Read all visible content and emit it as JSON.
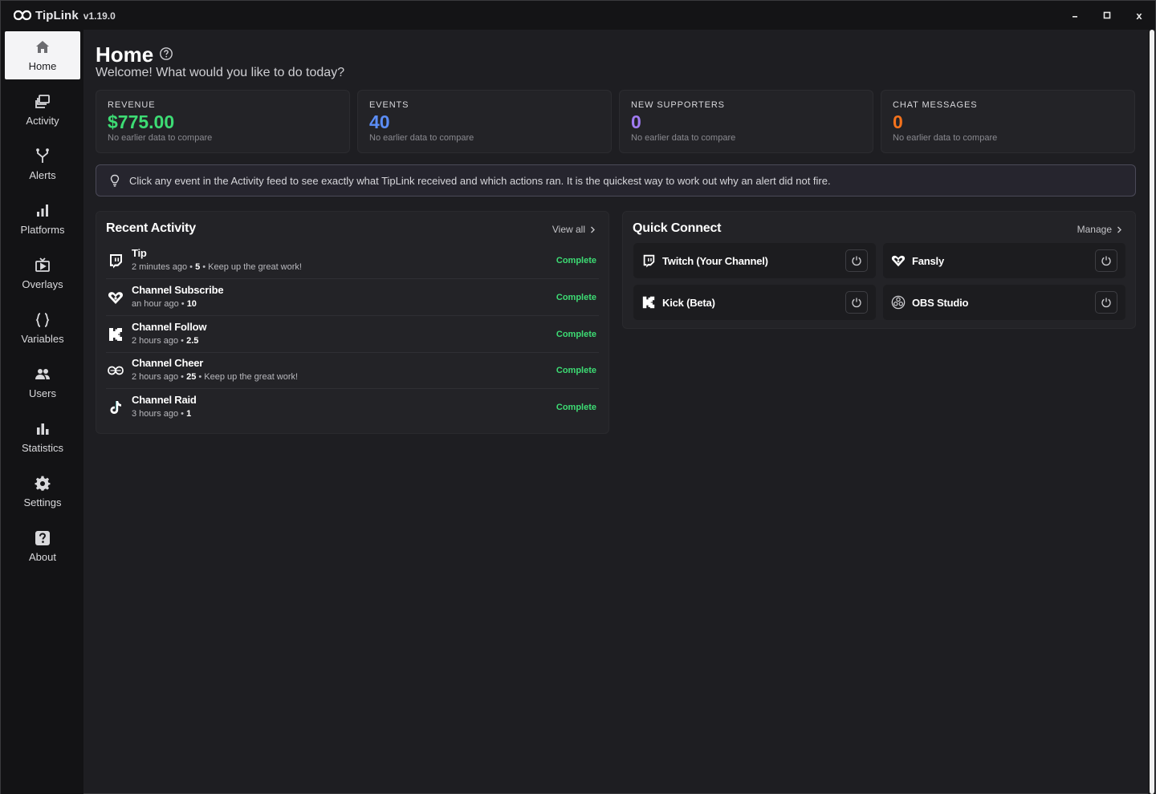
{
  "app": {
    "name": "TipLink",
    "version": "v1.19.0"
  },
  "window_controls": {
    "minimize": "–",
    "maximize": "□",
    "close": "x"
  },
  "sidebar": {
    "items": [
      {
        "label": "Home",
        "icon": "home-icon",
        "active": true
      },
      {
        "label": "Activity",
        "icon": "activity-icon"
      },
      {
        "label": "Alerts",
        "icon": "alerts-icon"
      },
      {
        "label": "Platforms",
        "icon": "platforms-icon"
      },
      {
        "label": "Overlays",
        "icon": "overlays-icon"
      },
      {
        "label": "Variables",
        "icon": "variables-icon"
      },
      {
        "label": "Users",
        "icon": "users-icon"
      },
      {
        "label": "Statistics",
        "icon": "statistics-icon"
      },
      {
        "label": "Settings",
        "icon": "gear-icon"
      },
      {
        "label": "About",
        "icon": "help-icon"
      }
    ]
  },
  "header": {
    "title": "Home",
    "subtitle": "Welcome! What would you like to do today?"
  },
  "stats": [
    {
      "label": "REVENUE",
      "value": "$775.00",
      "note": "No earlier data to compare",
      "color": "#3ddc74"
    },
    {
      "label": "EVENTS",
      "value": "40",
      "note": "No earlier data to compare",
      "color": "#5b8df6"
    },
    {
      "label": "NEW SUPPORTERS",
      "value": "0",
      "note": "No earlier data to compare",
      "color": "#a07bf2"
    },
    {
      "label": "CHAT MESSAGES",
      "value": "0",
      "note": "No earlier data to compare",
      "color": "#f5721c"
    }
  ],
  "tip": {
    "text": "Click any event in the Activity feed to see exactly what TipLink received and which actions ran. It is the quickest way to work out why an alert did not fire."
  },
  "recent_activity": {
    "title": "Recent Activity",
    "link": "View all",
    "items": [
      {
        "title": "Tip",
        "time": "2 minutes ago",
        "amount": "5",
        "message": "Keep up the great work!",
        "status": "Complete",
        "platform_icon": "twitch-icon"
      },
      {
        "title": "Channel Subscribe",
        "time": "an hour ago",
        "amount": "10",
        "message": "",
        "status": "Complete",
        "platform_icon": "fansly-icon"
      },
      {
        "title": "Channel Follow",
        "time": "2 hours ago",
        "amount": "2.5",
        "message": "",
        "status": "Complete",
        "platform_icon": "kick-icon"
      },
      {
        "title": "Channel Cheer",
        "time": "2 hours ago",
        "amount": "25",
        "message": "Keep up the great work!",
        "status": "Complete",
        "platform_icon": "tiplink-icon"
      },
      {
        "title": "Channel Raid",
        "time": "3 hours ago",
        "amount": "1",
        "message": "",
        "status": "Complete",
        "platform_icon": "tiktok-icon"
      }
    ]
  },
  "quick_connect": {
    "title": "Quick Connect",
    "link": "Manage",
    "items": [
      {
        "label": "Twitch (Your Channel)",
        "icon": "twitch-icon"
      },
      {
        "label": "Fansly",
        "icon": "fansly-icon"
      },
      {
        "label": "Kick (Beta)",
        "icon": "kick-icon"
      },
      {
        "label": "OBS Studio",
        "icon": "obs-icon"
      }
    ]
  }
}
